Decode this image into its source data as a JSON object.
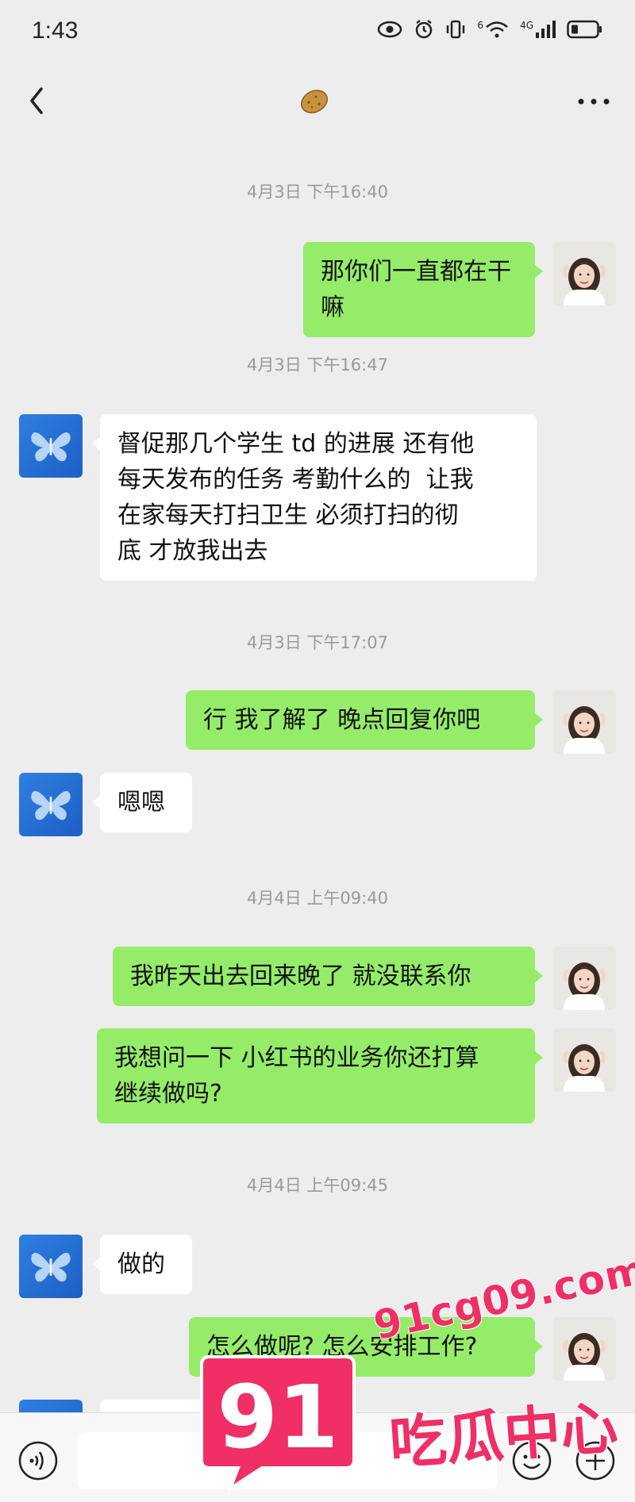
{
  "status_bar": {
    "time": "1:43",
    "network": "4G",
    "sim": "6"
  },
  "nav": {
    "title_icon": "potato-emoji",
    "back_icon": "chevron-left-icon",
    "more_icon": "more-horizontal-icon"
  },
  "messages": [
    {
      "type": "timestamp",
      "text": "4月3日 下午16:40"
    },
    {
      "type": "message",
      "sender": "me",
      "text": "那你们一直都在干嘛"
    },
    {
      "type": "timestamp",
      "text": "4月3日 下午16:47"
    },
    {
      "type": "message",
      "sender": "them",
      "text": "督促那几个学生 td 的进展 还有他\n每天发布的任务 考勤什么的  让我\n在家每天打扫卫生 必须打扫的彻\n底 才放我出去"
    },
    {
      "type": "timestamp",
      "text": "4月3日 下午17:07"
    },
    {
      "type": "message",
      "sender": "me",
      "text": "行 我了解了 晚点回复你吧"
    },
    {
      "type": "message",
      "sender": "them",
      "text": "嗯嗯"
    },
    {
      "type": "timestamp",
      "text": "4月4日 上午09:40"
    },
    {
      "type": "message",
      "sender": "me",
      "text": "我昨天出去回来晚了 就没联系你"
    },
    {
      "type": "message",
      "sender": "me",
      "text": "我想问一下 小红书的业务你还打算\n继续做吗?"
    },
    {
      "type": "timestamp",
      "text": "4月4日 上午09:45"
    },
    {
      "type": "message",
      "sender": "them",
      "text": "做的"
    },
    {
      "type": "message",
      "sender": "me",
      "text": "怎么做呢? 怎么安排工作?"
    }
  ],
  "input_bar": {
    "voice_icon": "voice-icon",
    "placeholder": "",
    "emoji_icon": "emoji-icon",
    "plus_icon": "plus-icon"
  },
  "watermark": {
    "url": "91cg09.com",
    "number": "91",
    "text": "吃瓜中心"
  },
  "colors": {
    "background": "#ededed",
    "my_bubble": "#95ec69",
    "their_bubble": "#ffffff",
    "watermark": "#ef2f66"
  }
}
